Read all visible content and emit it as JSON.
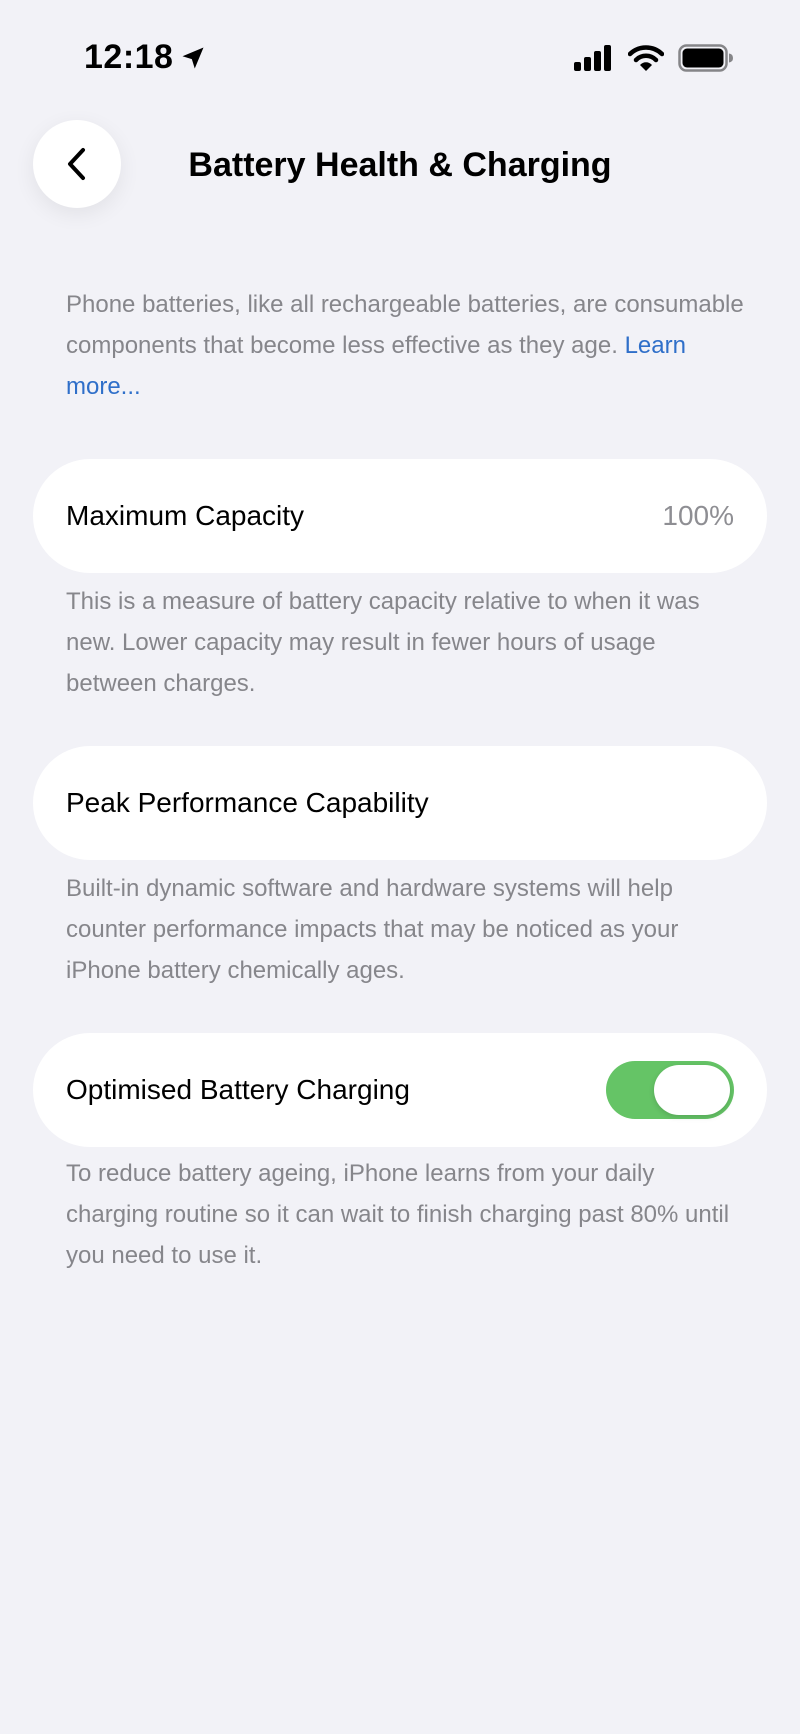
{
  "status_bar": {
    "time": "12:18"
  },
  "nav": {
    "title": "Battery Health & Charging"
  },
  "intro": {
    "text": "Phone batteries, like all rechargeable batteries, are consumable components that become less effective as they age. ",
    "link": "Learn more..."
  },
  "rows": {
    "max_capacity": {
      "label": "Maximum Capacity",
      "value": "100%",
      "description": "This is a measure of battery capacity relative to when it was new. Lower capacity may result in fewer hours of usage between charges."
    },
    "peak_performance": {
      "label": "Peak Performance Capability",
      "description": "Built-in dynamic software and hardware systems will help counter performance impacts that may be noticed as your iPhone battery chemically ages."
    },
    "optimised_charging": {
      "label": "Optimised Battery Charging",
      "toggle_on": true,
      "description": "To reduce battery ageing, iPhone learns from your daily charging routine so it can wait to finish charging past 80% until you need to use it."
    }
  },
  "colors": {
    "background": "#f2f2f7",
    "card": "#ffffff",
    "secondary_text": "#86868b",
    "link": "#2f6fc9",
    "toggle_on": "#65c466"
  },
  "icons": {
    "location": "location-arrow-icon",
    "signal": "cellular-signal-icon",
    "wifi": "wifi-icon",
    "battery": "battery-full-icon",
    "back": "chevron-left-icon"
  }
}
